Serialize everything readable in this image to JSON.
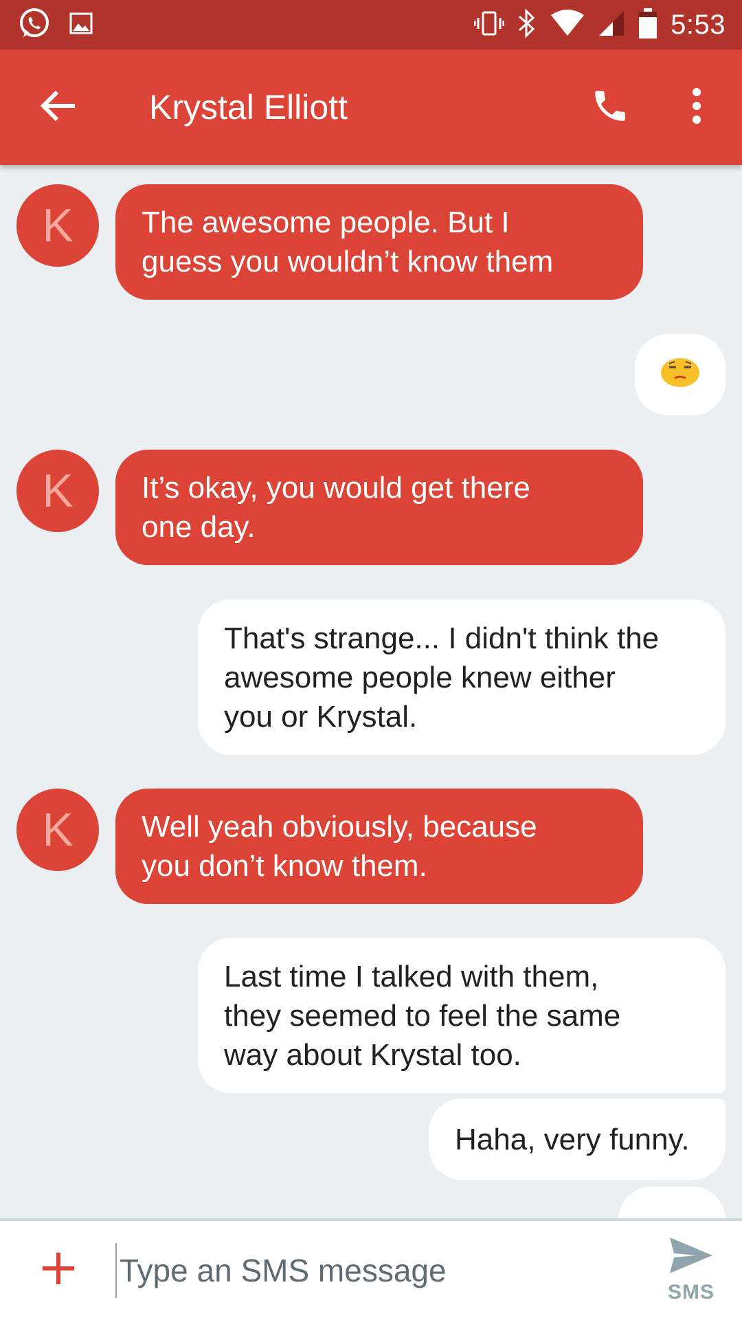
{
  "status_bar": {
    "time": "5:53",
    "icons": [
      "whatsapp-icon",
      "image-icon",
      "vibrate-icon",
      "bluetooth-icon",
      "wifi-icon",
      "signal-icon",
      "battery-icon"
    ]
  },
  "app_bar": {
    "contact_name": "Krystal Elliott",
    "icons": [
      "back-arrow-icon",
      "phone-icon",
      "more-vert-icon"
    ]
  },
  "messages": [
    {
      "direction": "in",
      "avatar_letter": "K",
      "text": "The awesome people. But I\nguess you wouldn’t know them"
    },
    {
      "direction": "out",
      "text": "😒"
    },
    {
      "direction": "in",
      "avatar_letter": "K",
      "text": "It’s okay, you would get there\none day."
    },
    {
      "direction": "out",
      "text": "That's strange... I didn't think the\nawesome people knew either\nyou or Krystal."
    },
    {
      "direction": "in",
      "avatar_letter": "K",
      "text": "Well yeah obviously, because\nyou don’t know them."
    },
    {
      "direction": "out",
      "text": "Last time I talked with them,\nthey seemed to feel the same\nway about Krystal too."
    },
    {
      "direction": "out",
      "text": "Haha, very funny."
    }
  ],
  "compose": {
    "placeholder": "Type an SMS message",
    "value": "",
    "send_label": "SMS"
  },
  "colors": {
    "status_bar": "#b0342c",
    "app_bar": "#db4437",
    "incoming_bubble": "#db4437",
    "outgoing_bubble": "#ffffff",
    "background": "#eceff1"
  }
}
